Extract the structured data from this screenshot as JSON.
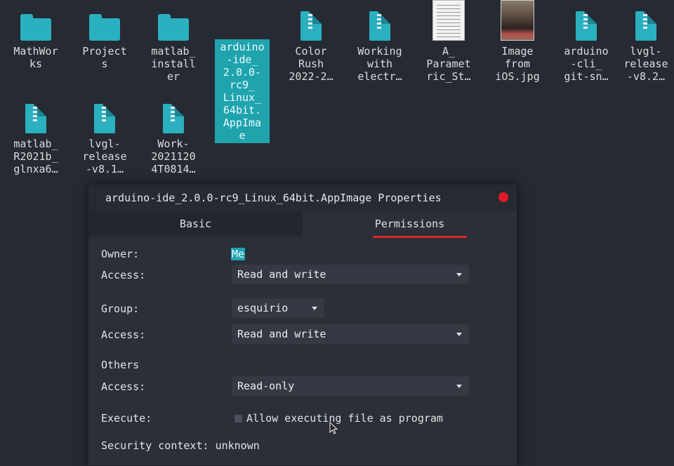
{
  "desktop": {
    "files": [
      {
        "label": "MathWor\nks",
        "icon": "folder-icon"
      },
      {
        "label": "Project\ns",
        "icon": "folder-icon"
      },
      {
        "label": "matlab_\ninstall\ner",
        "icon": "folder-icon"
      },
      {
        "label": "arduino\n-ide_\n2.0.0-\nrc9_\nLinux_\n64bit.\nAppIma\ne",
        "icon": "none",
        "selected": true
      },
      {
        "label": "Color\nRush\n2022-2…",
        "icon": "archive-icon"
      },
      {
        "label": "Working\nwith\nelectr…",
        "icon": "archive-icon"
      },
      {
        "label": "A_\nParamet\nric_St…",
        "icon": "document-thumbnail"
      },
      {
        "label": "Image\nfrom\niOS.jpg",
        "icon": "photo-thumbnail"
      },
      {
        "label": "arduino\n-cli_\ngit-sn…",
        "icon": "archive-icon"
      },
      {
        "label": "lvgl-\nrelease\n-v8.2…",
        "icon": "archive-icon"
      },
      {
        "label": "matlab_\nR2021b_\nglnxa6…",
        "icon": "archive-icon"
      },
      {
        "label": "lvgl-\nrelease\n-v8.1…",
        "icon": "archive-icon"
      },
      {
        "label": "Work-\n2021120\n4T0814…",
        "icon": "archive-icon"
      }
    ]
  },
  "dialog": {
    "title": "arduino-ide_2.0.0-rc9_Linux_64bit.AppImage Properties",
    "tabs": [
      {
        "label": "Basic",
        "active": false
      },
      {
        "label": "Permissions",
        "active": true
      }
    ],
    "owner_label": "Owner:",
    "owner_value": "Me",
    "owner_access_label": "Access:",
    "owner_access_value": "Read and write",
    "group_label": "Group:",
    "group_value": "esquirio",
    "group_access_label": "Access:",
    "group_access_value": "Read and write",
    "others_label": "Others",
    "others_access_label": "Access:",
    "others_access_value": "Read-only",
    "execute_label": "Execute:",
    "execute_checkbox_label": "Allow executing file as program",
    "security_context_label": "Security context:",
    "security_context_value": "unknown"
  },
  "colors": {
    "background": "#262a33",
    "accent": "#1fa3ad",
    "close_button": "#e01b24",
    "tab_underline": "#e0262b"
  }
}
